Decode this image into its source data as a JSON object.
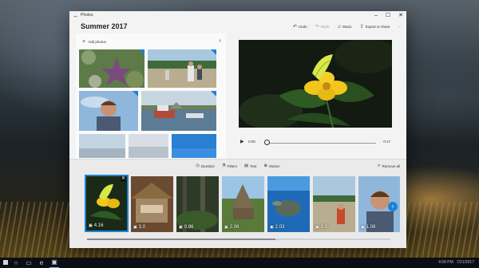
{
  "window": {
    "app_name": "Photos",
    "project_title": "Summer 2017",
    "controls": {
      "minimize": "–",
      "maximize": "☐",
      "close": "✕"
    }
  },
  "toolbar": {
    "undo": "Undo",
    "redo": "Redo",
    "music": "Music",
    "export": "Export or share",
    "more": "···"
  },
  "library": {
    "add_photos": "Add photos",
    "photos": [
      {
        "name": "starfish-rocks"
      },
      {
        "name": "beach-family"
      },
      {
        "name": "boy-portrait"
      },
      {
        "name": "harbor-boats"
      },
      {
        "name": "row3-a"
      },
      {
        "name": "row3-b"
      },
      {
        "name": "row3-c"
      }
    ]
  },
  "player": {
    "time_start": "0:00",
    "time_end": "0:17",
    "progress": 0.0
  },
  "storyboard": {
    "tools": {
      "duration": "Duration",
      "filters": "Filters",
      "text": "Text",
      "motion": "Motion"
    },
    "remove_all": "Remove all",
    "cards": [
      {
        "duration": "4.16",
        "selected": true
      },
      {
        "duration": "3.0"
      },
      {
        "duration": "0.96"
      },
      {
        "duration": "2.06"
      },
      {
        "duration": "2.03"
      },
      {
        "duration": "1.0"
      },
      {
        "duration": "1.06"
      }
    ]
  },
  "taskbar": {
    "time": "4:08 PM",
    "date": "7/21/2017"
  },
  "colors": {
    "accent": "#1c82d6",
    "window_bg": "#f3f3f3",
    "storyboard_bg": "#eaeaea"
  }
}
